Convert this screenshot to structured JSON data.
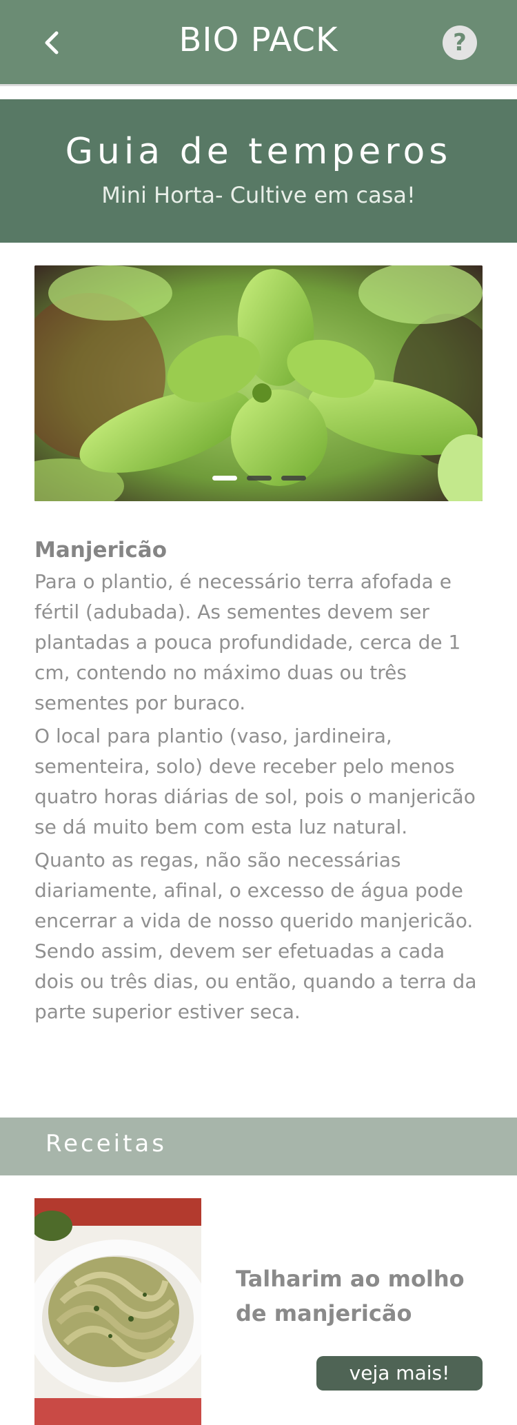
{
  "header": {
    "title": "BIO PACK",
    "back_icon": "chevron-left-icon",
    "help_icon": "question-circle-icon",
    "help_glyph": "?"
  },
  "hero": {
    "title": "Guia de temperos",
    "subtitle": "Mini Horta- Cultive em casa!"
  },
  "carousel": {
    "slide_count": 3,
    "active_index": 0
  },
  "article": {
    "name": "Manjericão",
    "paragraphs": [
      "Para o plantio, é necessário terra afofada e fértil (adubada). As sementes devem ser plantadas a pouca profundidade, cerca de 1 cm, contendo no máximo duas ou três sementes por buraco.",
      " O local para plantio (vaso, jardineira, sementeira, solo) deve receber pelo menos quatro horas diárias de sol, pois o manjericão se dá muito bem com esta luz natural.",
      "Quanto as regas, não são necessárias diariamente, afinal, o excesso de água pode encerrar a vida de nosso querido manjericão. Sendo assim, devem ser efetuadas a cada dois ou três dias, ou então, quando a terra da parte superior estiver seca."
    ]
  },
  "recipes": {
    "section_label": "Receitas",
    "items": [
      {
        "title": "Talharim ao molho de manjericão",
        "button": "veja mais!"
      }
    ]
  },
  "colors": {
    "topbar": "#6b8c74",
    "hero": "#587965",
    "band": "#a7b5aa",
    "button": "#4f6455"
  }
}
